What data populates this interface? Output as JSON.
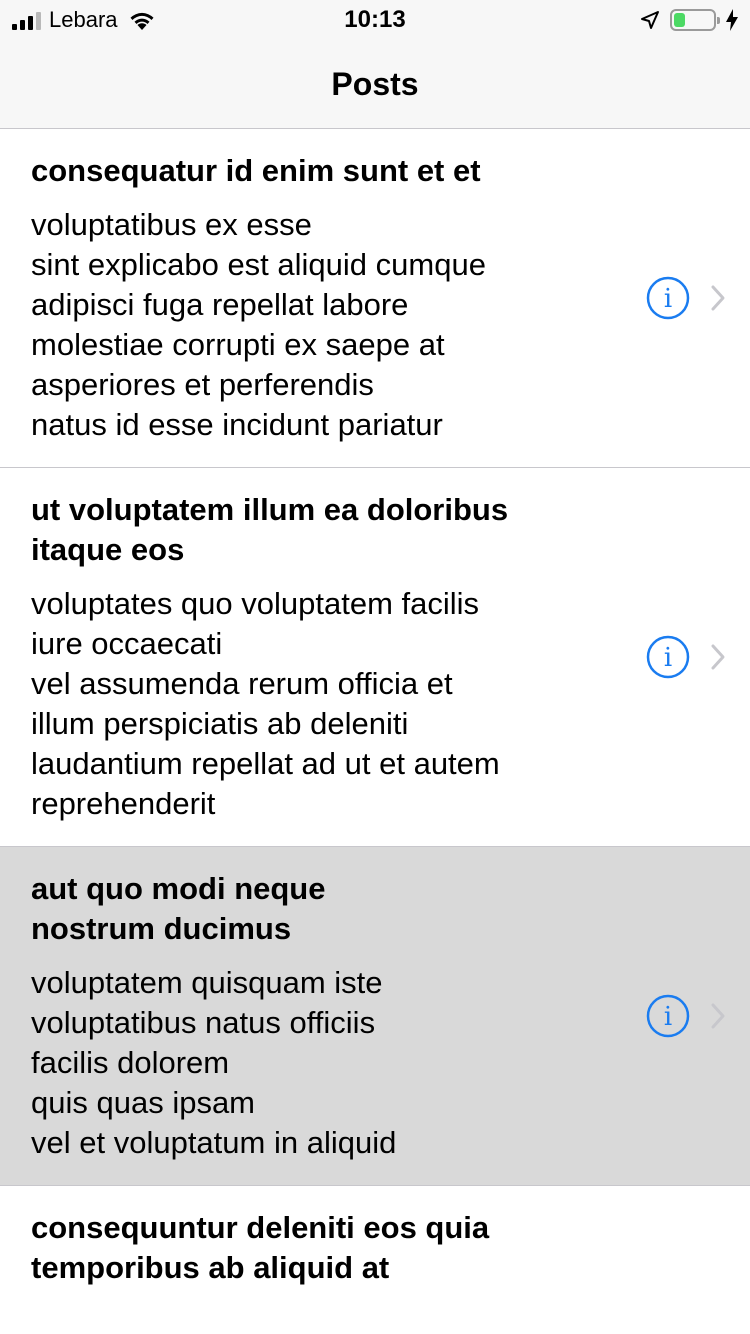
{
  "status_bar": {
    "carrier": "Lebara",
    "time": "10:13",
    "battery_level_fraction": 0.3,
    "battery_color": "#4cd964",
    "icons": [
      "signal-icon",
      "wifi-icon",
      "location-icon",
      "battery-icon",
      "charging-icon"
    ]
  },
  "nav": {
    "title": "Posts"
  },
  "colors": {
    "accent": "#1a7cf0",
    "selected_row": "#d9d9d9",
    "separator": "#c8c7cc",
    "chevron": "#c7c7cc"
  },
  "posts": [
    {
      "title": "consequatur id enim sunt et et",
      "body": "voluptatibus ex esse\nsint explicabo est aliquid cumque\nadipisci fuga repellat labore\nmolestiae corrupti ex saepe at\nasperiores et perferendis\nnatus id esse incidunt pariatur"
    },
    {
      "title": "ut voluptatem illum ea doloribus itaque eos",
      "body": "voluptates quo voluptatem facilis\niure occaecati\nvel assumenda rerum officia et\nillum perspiciatis ab deleniti\nlaudantium repellat ad ut et autem\nreprehenderit"
    },
    {
      "title": "aut quo modi neque\nnostrum ducimus",
      "body": "voluptatem quisquam iste\nvoluptatibus natus officiis\nfacilis dolorem\nquis quas ipsam\nvel et voluptatum in aliquid"
    },
    {
      "title": "consequuntur deleniti eos quia temporibus ab aliquid at",
      "body": ""
    }
  ]
}
